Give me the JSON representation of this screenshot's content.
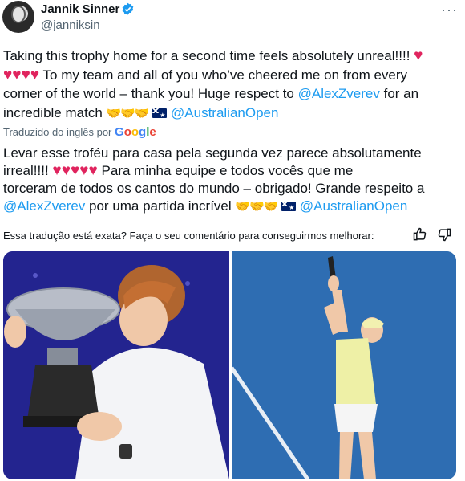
{
  "author": {
    "name": "Jannik Sinner",
    "handle": "@janniksin"
  },
  "tweet": {
    "line1": "Taking this trophy home for a second time feels absolutely unreal!!!! ",
    "line2": " To my team and all of you who’ve cheered me on from every",
    "line3": "corner of the world – thank you! Huge respect to ",
    "mention1": "@AlexZverev",
    "line3b": " for an",
    "line4": "incredible match ",
    "mention2": "@AustralianOpen"
  },
  "translation": {
    "label": "Traduzido do inglês por",
    "by": "Google"
  },
  "translated_tweet": {
    "line1": "Levar esse troféu para casa pela segunda vez parece absolutamente",
    "line2": "irreal!!!! ",
    "line2b": " Para minha equipe e todos vocês que me",
    "line3": "torceram de todos os cantos do mundo – obrigado! Grande respeito a",
    "mention1": "@AlexZverev",
    "line4": " por uma partida incrível ",
    "mention2": "@AustralianOpen"
  },
  "feedback": {
    "text": "Essa tradução está exata? Faça o seu comentário para conseguirmos melhorar:"
  },
  "icons": {
    "verified": "verified-badge-icon",
    "more": "more-options-icon",
    "thumbs_up": "thumbs-up-icon",
    "thumbs_down": "thumbs-down-icon"
  },
  "colors": {
    "link": "#1d9bf0",
    "heart": "#e0245e",
    "secondary_text": "#536471"
  }
}
